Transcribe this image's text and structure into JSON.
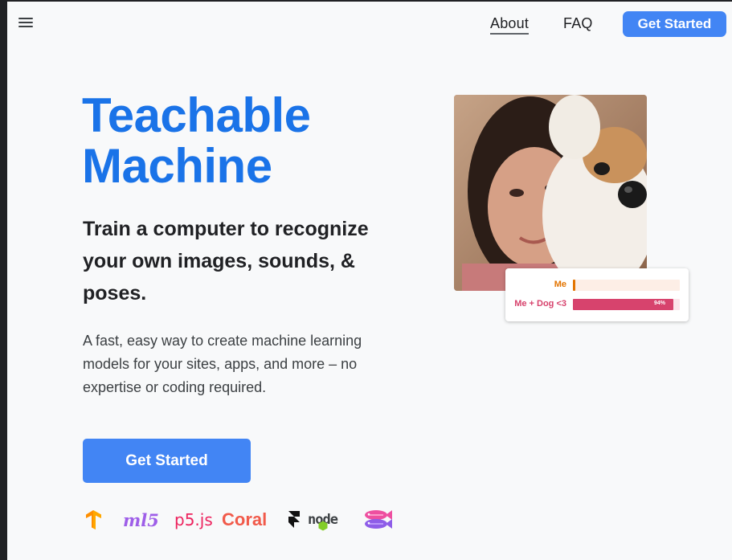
{
  "nav": {
    "about": "About",
    "faq": "FAQ",
    "cta": "Get Started"
  },
  "hero": {
    "title_line1": "Teachable",
    "title_line2": "Machine",
    "subtitle": "Train a computer to recognize your own images, sounds, & poses.",
    "description": "A fast, easy way to create machine learning models for your sites, apps, and more – no expertise or coding required.",
    "cta": "Get Started"
  },
  "logos": {
    "ml5": "ml5",
    "p5": "p5.js",
    "coral": "Coral",
    "node": "node"
  },
  "predictions": [
    {
      "label": "Me",
      "value": 0.02,
      "color": "#e37400",
      "track": "#fdeee6",
      "pct": ""
    },
    {
      "label": "Me + Dog <3",
      "value": 0.94,
      "color": "#d7436d",
      "track": "#fbe5ea",
      "pct": "94%"
    }
  ],
  "colors": {
    "brand_blue": "#1a73e8",
    "button_blue": "#4285f4"
  }
}
